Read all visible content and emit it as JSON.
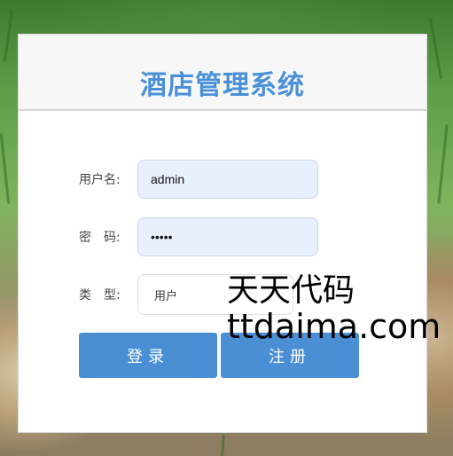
{
  "title": "酒店管理系统",
  "form": {
    "username_label": "用户名:",
    "username_value": "admin",
    "password_label": "密　码:",
    "password_value": "•••••",
    "type_label": "类　型:",
    "type_value": "用户"
  },
  "buttons": {
    "login": "登录",
    "register": "注册"
  },
  "watermark": {
    "line1": "天天代码",
    "line2": "ttdaima.com"
  },
  "colors": {
    "accent": "#4a8fd4",
    "title": "#4a90d9",
    "input_bg": "#e8f0fe"
  }
}
